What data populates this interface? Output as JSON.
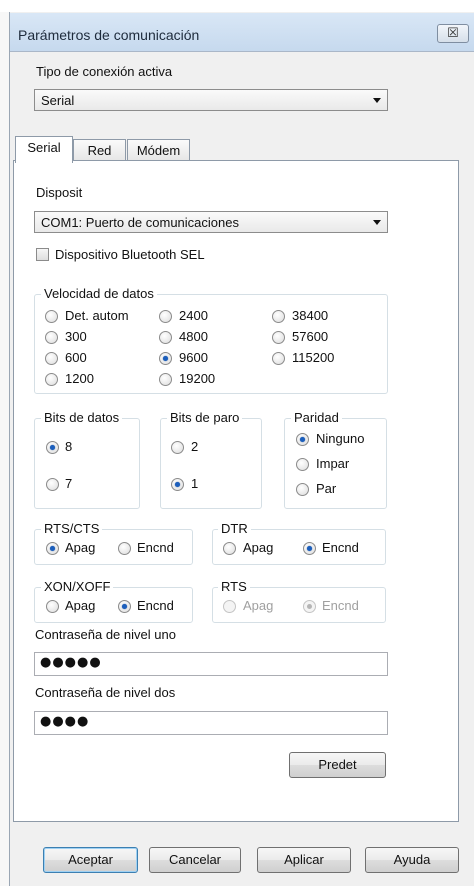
{
  "window": {
    "title": "Parámetros de comunicación",
    "close_glyph": "☒"
  },
  "connection": {
    "label": "Tipo de conexión activa",
    "value": "Serial"
  },
  "tabs": [
    {
      "label": "Serial"
    },
    {
      "label": "Red"
    },
    {
      "label": "Módem"
    }
  ],
  "serial": {
    "device_label": "Disposit",
    "device_value": "COM1: Puerto de comunicaciones",
    "bluetooth_label": "Dispositivo Bluetooth SEL",
    "bluetooth_checked": false,
    "data_rate": {
      "title": "Velocidad de datos",
      "options": [
        "Det. autom",
        "300",
        "600",
        "1200",
        "2400",
        "4800",
        "9600",
        "19200",
        "38400",
        "57600",
        "115200"
      ],
      "selected": "9600"
    },
    "data_bits": {
      "title": "Bits de datos",
      "options": [
        "8",
        "7"
      ],
      "selected": "8"
    },
    "stop_bits": {
      "title": "Bits de paro",
      "options": [
        "2",
        "1"
      ],
      "selected": "1"
    },
    "parity": {
      "title": "Paridad",
      "options": [
        "Ninguno",
        "Impar",
        "Par"
      ],
      "selected": "Ninguno"
    },
    "rts_cts": {
      "title": "RTS/CTS",
      "options": [
        "Apag",
        "Encnd"
      ],
      "selected": "Apag"
    },
    "dtr": {
      "title": "DTR",
      "options": [
        "Apag",
        "Encnd"
      ],
      "selected": "Encnd"
    },
    "xon_xoff": {
      "title": "XON/XOFF",
      "options": [
        "Apag",
        "Encnd"
      ],
      "selected": "Encnd"
    },
    "rts": {
      "title": "RTS",
      "options": [
        "Apag",
        "Encnd"
      ],
      "selected": "Encnd",
      "disabled": true
    },
    "password1": {
      "label": "Contraseña de nivel uno",
      "value": "●●●●●"
    },
    "password2": {
      "label": "Contraseña de nivel dos",
      "value": "●●●●"
    },
    "default_button": "Predet"
  },
  "footer": {
    "ok": "Aceptar",
    "cancel": "Cancelar",
    "apply": "Aplicar",
    "help": "Ayuda"
  }
}
